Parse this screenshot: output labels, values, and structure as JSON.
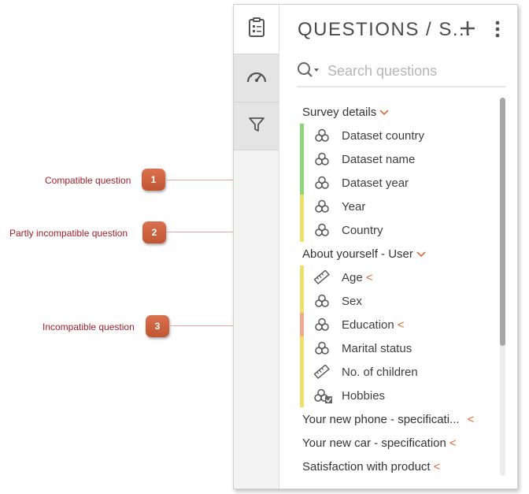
{
  "annotations": [
    {
      "number": "1",
      "label": "Compatible question"
    },
    {
      "number": "2",
      "label": "Partly incompatible question"
    },
    {
      "number": "3",
      "label": "Incompatible question"
    }
  ],
  "header": {
    "title": "QUESTIONS / S...",
    "add_icon": "plus-icon",
    "menu_icon": "kebab-menu-icon"
  },
  "rail": {
    "items": [
      {
        "icon": "clipboard-list-icon"
      },
      {
        "icon": "speedometer-icon"
      },
      {
        "icon": "filter-icon"
      }
    ]
  },
  "search": {
    "placeholder": "Search questions",
    "icon": "search-icon"
  },
  "tree": {
    "sections": [
      {
        "label": "Survey details",
        "expanded": true,
        "items": [
          {
            "label": "Dataset country",
            "icon": "categorical-icon",
            "status": "compatible"
          },
          {
            "label": "Dataset name",
            "icon": "categorical-icon",
            "status": "compatible"
          },
          {
            "label": "Dataset year",
            "icon": "categorical-icon",
            "status": "compatible"
          },
          {
            "label": "Year",
            "icon": "categorical-icon",
            "status": "partly"
          },
          {
            "label": "Country",
            "icon": "categorical-icon",
            "status": "partly"
          }
        ]
      },
      {
        "label": "About yourself - User",
        "expanded": true,
        "items": [
          {
            "label": "Age",
            "icon": "ruler-icon",
            "status": "partly",
            "caret": "<"
          },
          {
            "label": "Sex",
            "icon": "categorical-icon",
            "status": "partly"
          },
          {
            "label": "Education",
            "icon": "categorical-icon",
            "status": "incompatible",
            "caret": "<"
          },
          {
            "label": "Marital status",
            "icon": "categorical-icon",
            "status": "partly"
          },
          {
            "label": "No. of children",
            "icon": "ruler-icon",
            "status": "partly"
          },
          {
            "label": "Hobbies",
            "icon": "multi-categorical-icon",
            "status": "partly"
          }
        ]
      },
      {
        "label": "Your new phone - specificati...",
        "expanded": false,
        "caret": "<"
      },
      {
        "label": "Your new car - specification",
        "expanded": false,
        "caret": "<"
      },
      {
        "label": "Satisfaction with product",
        "expanded": false,
        "caret": "<"
      }
    ]
  },
  "colors": {
    "compatible": "#8fd67a",
    "partly": "#ece26a",
    "incompatible": "#f0a890",
    "accent": "#e06a35"
  },
  "expand_caret": "⌄",
  "scroll_position": 0.0,
  "scroll_visible_fraction": 0.66
}
